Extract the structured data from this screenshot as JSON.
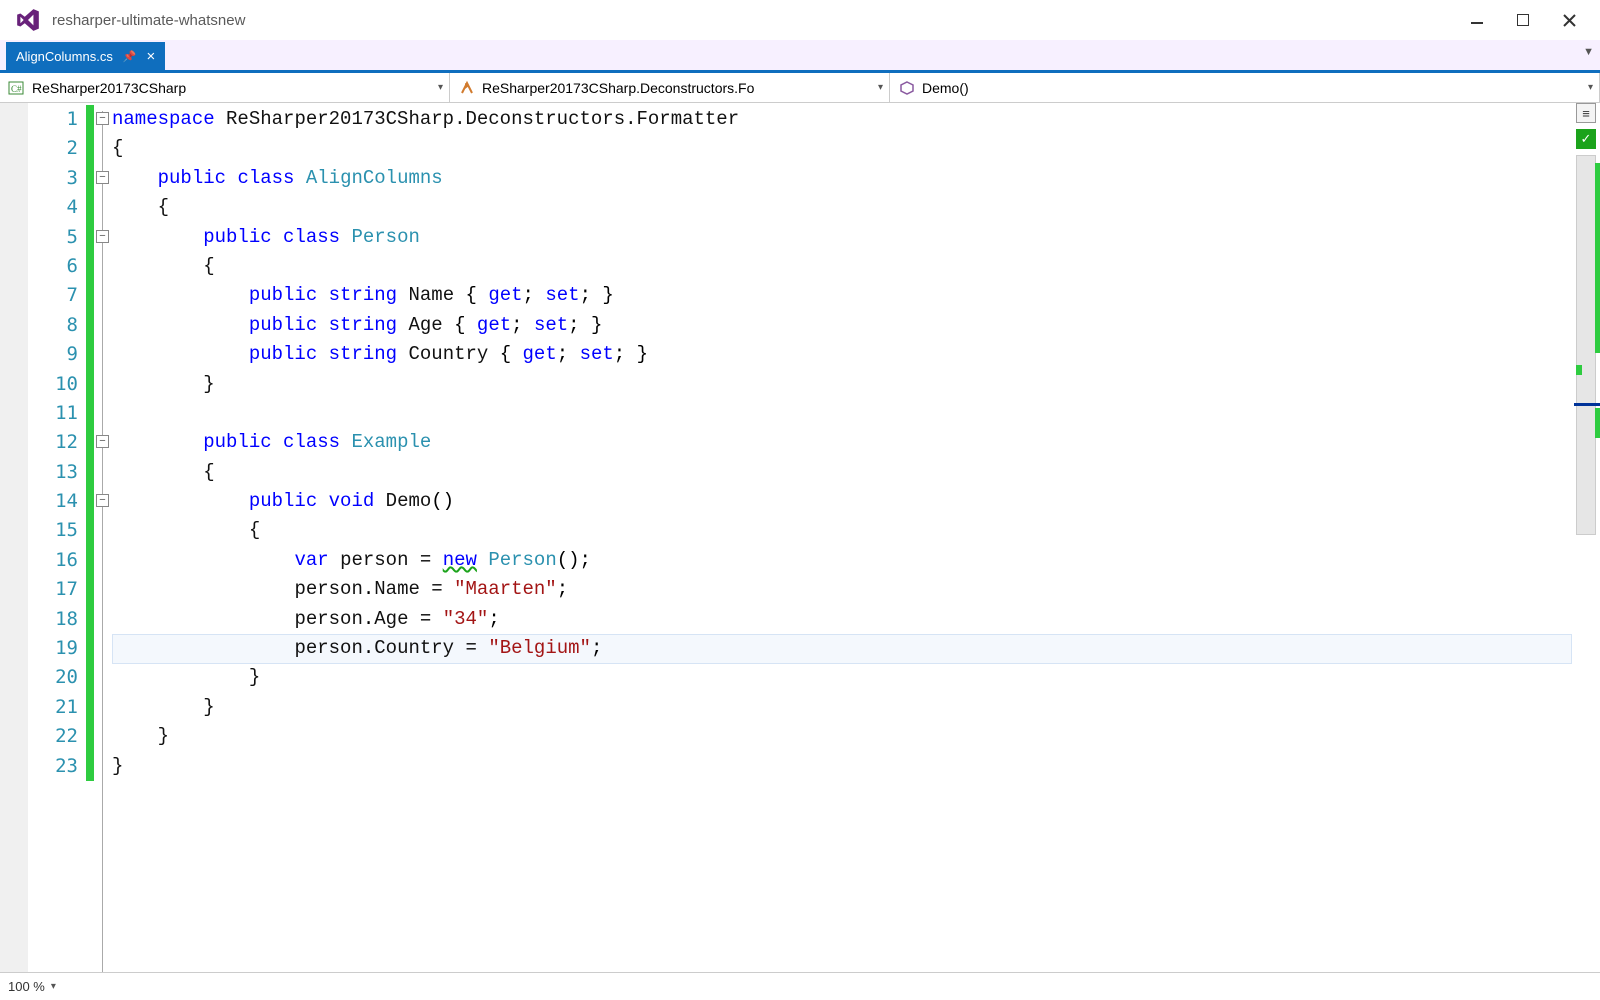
{
  "window": {
    "title": "resharper-ultimate-whatsnew"
  },
  "tab": {
    "name": "AlignColumns.cs"
  },
  "nav": {
    "crumb1": "ReSharper20173CSharp",
    "crumb2": "ReSharper20173CSharp.Deconstructors.Fo",
    "crumb3": "Demo()"
  },
  "status": {
    "zoom": "100 %"
  },
  "code": {
    "line_count": 23,
    "highlight_line": 19,
    "fold_points": [
      1,
      3,
      5,
      12,
      14
    ],
    "tokens": {
      "namespace": "namespace",
      "public": "public",
      "class": "class",
      "string": "string",
      "void": "void",
      "var": "var",
      "new": "new",
      "get": "get",
      "set": "set",
      "ns_path": "ReSharper20173CSharp.Deconstructors.Formatter",
      "cls_AlignColumns": "AlignColumns",
      "cls_Person": "Person",
      "cls_Example": "Example",
      "m_Demo": "Demo",
      "p_Name": "Name",
      "p_Age": "Age",
      "p_Country": "Country",
      "v_person": "person",
      "s_Maarten": "\"Maarten\"",
      "s_34": "\"34\"",
      "s_Belgium": "\"Belgium\""
    }
  }
}
